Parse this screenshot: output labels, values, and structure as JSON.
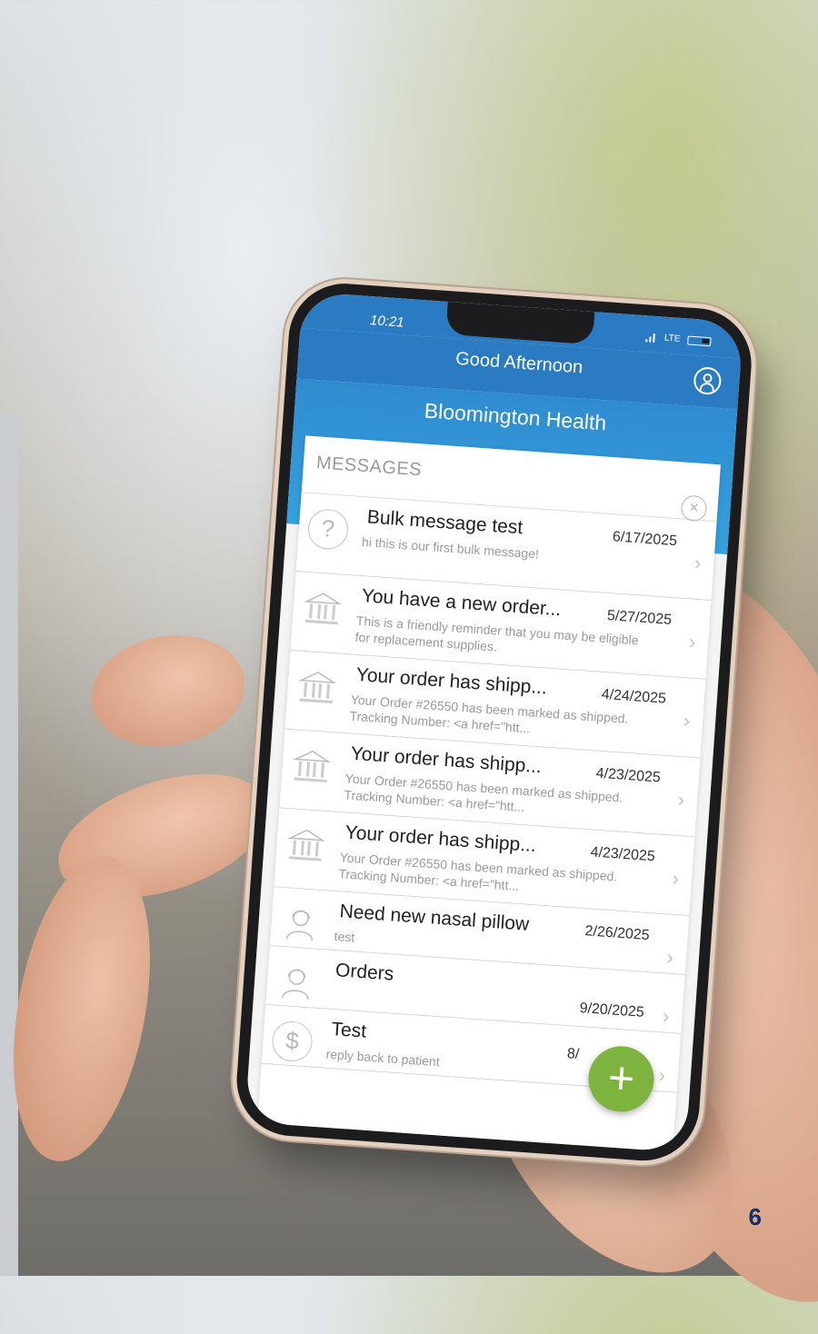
{
  "status_bar": {
    "time": "10:21",
    "network": "LTE"
  },
  "header": {
    "greeting": "Good Afternoon",
    "organization": "Bloomington Health"
  },
  "messages": {
    "title": "MESSAGES",
    "items": [
      {
        "icon": "question-icon",
        "title": "Bulk message test",
        "date": "6/17/2025",
        "preview": "hi this is our first bulk message!"
      },
      {
        "icon": "bank-icon",
        "title": "You have a new order...",
        "date": "5/27/2025",
        "preview": "This is a friendly reminder that you may be eligible for replacement supplies."
      },
      {
        "icon": "bank-icon",
        "title": "Your order has shipp...",
        "date": "4/24/2025",
        "preview": "Your Order #26550 has been marked as shipped. Tracking Number: <a href=\"htt..."
      },
      {
        "icon": "bank-icon",
        "title": "Your order has shipp...",
        "date": "4/23/2025",
        "preview": "Your Order #26550 has been marked as shipped. Tracking Number: <a href=\"htt..."
      },
      {
        "icon": "bank-icon",
        "title": "Your order has shipp...",
        "date": "4/23/2025",
        "preview": "Your Order #26550 has been marked as shipped. Tracking Number: <a href=\"htt..."
      },
      {
        "icon": "agent-icon",
        "title": "Need new nasal pillow",
        "date": "2/26/2025",
        "preview": "test"
      },
      {
        "icon": "agent-icon",
        "title": "Orders",
        "date": "9/20/2025",
        "preview": ""
      },
      {
        "icon": "dollar-icon",
        "title": "Test",
        "date": "8/",
        "preview": "reply back to patient"
      }
    ]
  },
  "fab_label": "+",
  "page_number": "6"
}
